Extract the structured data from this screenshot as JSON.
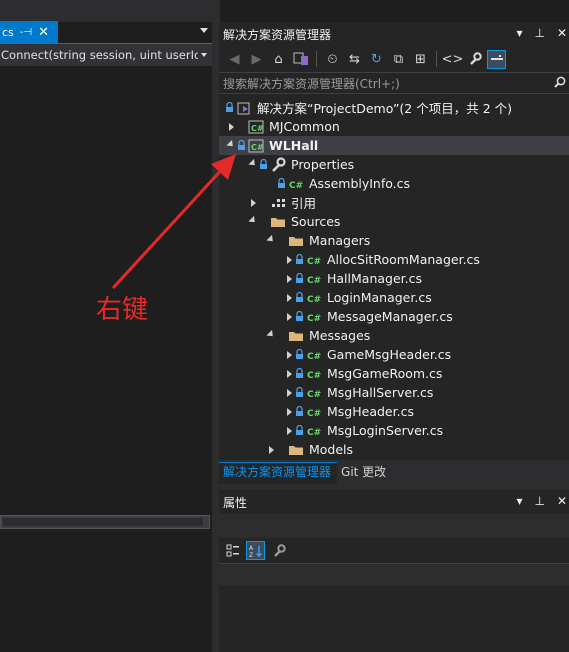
{
  "editor": {
    "tab_name": "cs",
    "tab_pin": "- ",
    "tab_close": "✕",
    "nav_text": "Connect(string session, uint userIc"
  },
  "solution_explorer": {
    "title": "解决方案资源管理器",
    "search_placeholder": "搜索解决方案资源管理器(Ctrl+;)",
    "items": [
      {
        "label": "解决方案“ProjectDemo”(2 个项目，共 2 个)"
      },
      {
        "label": "MJCommon"
      },
      {
        "label": "WLHall"
      },
      {
        "label": "Properties"
      },
      {
        "label": "AssemblyInfo.cs"
      },
      {
        "label": "引用"
      },
      {
        "label": "Sources"
      },
      {
        "label": "Managers"
      },
      {
        "label": "AllocSitRoomManager.cs"
      },
      {
        "label": "HallManager.cs"
      },
      {
        "label": "LoginManager.cs"
      },
      {
        "label": "MessageManager.cs"
      },
      {
        "label": "Messages"
      },
      {
        "label": "GameMsgHeader.cs"
      },
      {
        "label": "MsgGameRoom.cs"
      },
      {
        "label": "MsgHallServer.cs"
      },
      {
        "label": "MsgHeader.cs"
      },
      {
        "label": "MsgLoginServer.cs"
      },
      {
        "label": "Models"
      }
    ],
    "tabs": {
      "active": "解决方案资源管理器",
      "inactive": "Git 更改"
    }
  },
  "properties": {
    "title": "属性"
  },
  "annotation": {
    "text": "右键",
    "color": "#e52a2a"
  },
  "colors": {
    "accent": "#007acc",
    "csharp_icon": "#68d668",
    "folder": "#dcb67a",
    "lock": "#4aa0e6"
  }
}
